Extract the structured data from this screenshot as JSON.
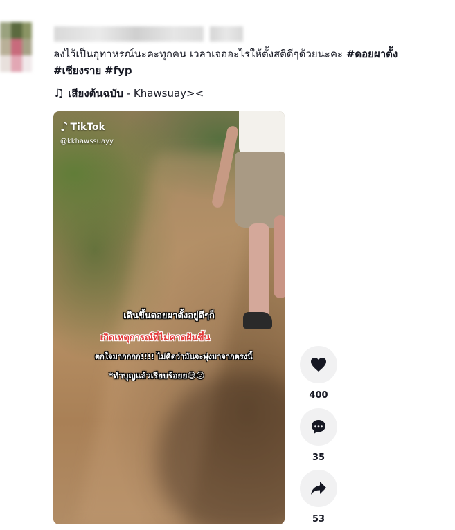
{
  "post": {
    "caption_text": "ลงไว้เป็นอุทาหรณ์นะคะทุกคน เวลาเจออะไรให้ตั้งสติดีๆด้วยนะคะ ",
    "hashtags": [
      "#ดอยผาตั้ง",
      "#เชียงราย",
      "#fyp"
    ],
    "music": {
      "icon": "music-note-icon",
      "note": "♫",
      "label": "เสียงต้นฉบับ",
      "artist": "- Khawsuay><"
    }
  },
  "video": {
    "watermark": "TikTok",
    "watermark_handle": "@kkhawssuayy",
    "overlay_lines": [
      "เดินขึ้นดอยผาตั้งอยู่ดีๆก็",
      "เกิดเหตุการณ์ที่ไม่คาดฝันขึ้น",
      "ตกใจมากกกก!!!! ไม่คิดว่ามันจะพุ่งมาจากตรงนี้",
      "*ทำบุญแล้วเรียบร้อยย😅😕"
    ]
  },
  "actions": {
    "like": {
      "icon": "heart-icon",
      "count": "400"
    },
    "comment": {
      "icon": "comment-icon",
      "count": "35"
    },
    "share": {
      "icon": "share-icon",
      "count": "53"
    }
  },
  "colors": {
    "text": "#161823",
    "action_bg": "#f1f1f2",
    "overlay_red": "#e23a3a"
  }
}
